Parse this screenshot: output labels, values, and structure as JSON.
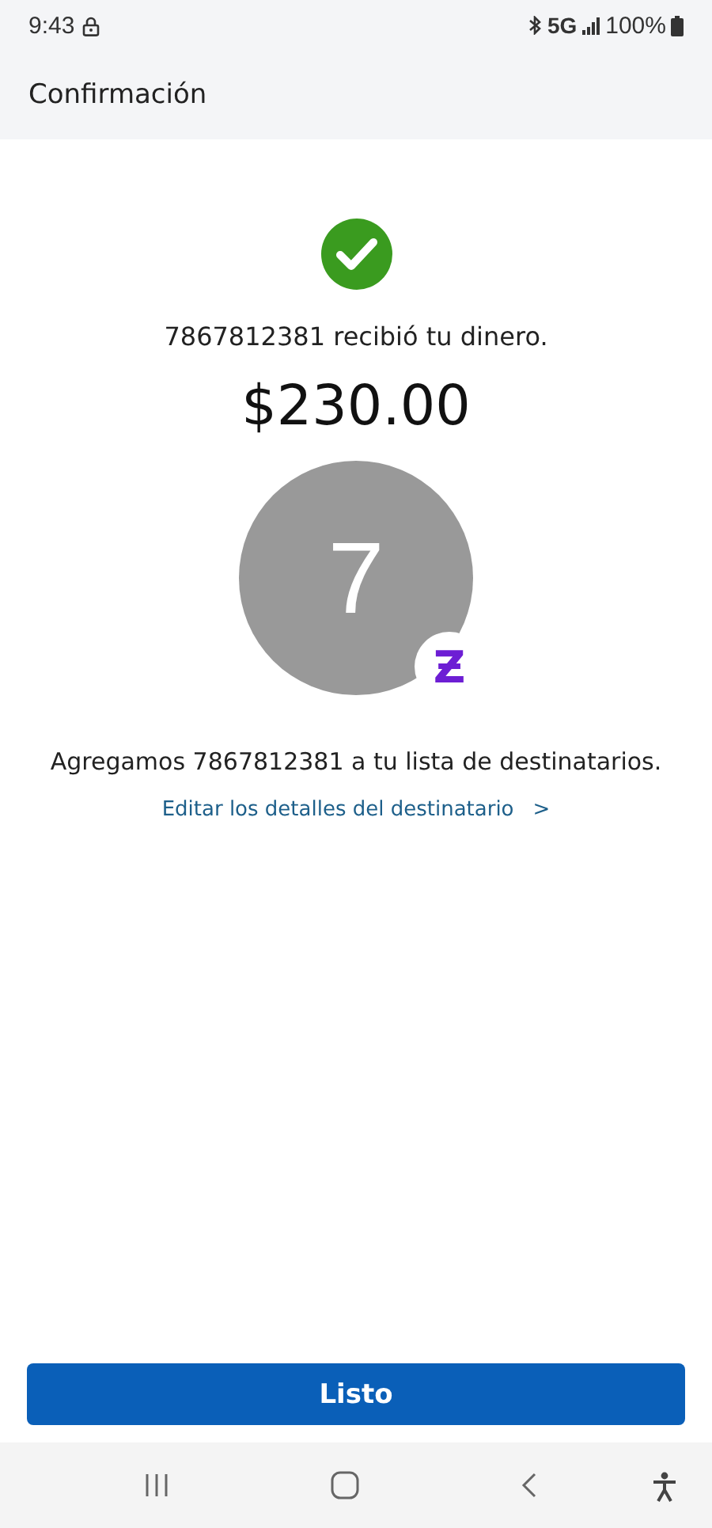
{
  "status_bar": {
    "time": "9:43",
    "network": "5G",
    "battery": "100%"
  },
  "header": {
    "title": "Confirmación"
  },
  "confirmation": {
    "message": "7867812381 recibió tu dinero.",
    "amount": "$230.00",
    "avatar_initial": "7",
    "badge": "Ƶ",
    "note": "Agregamos 7867812381 a tu lista de destinatarios.",
    "link": "Editar los detalles del destinatario",
    "link_arrow": ">"
  },
  "button": {
    "label": "Listo"
  }
}
